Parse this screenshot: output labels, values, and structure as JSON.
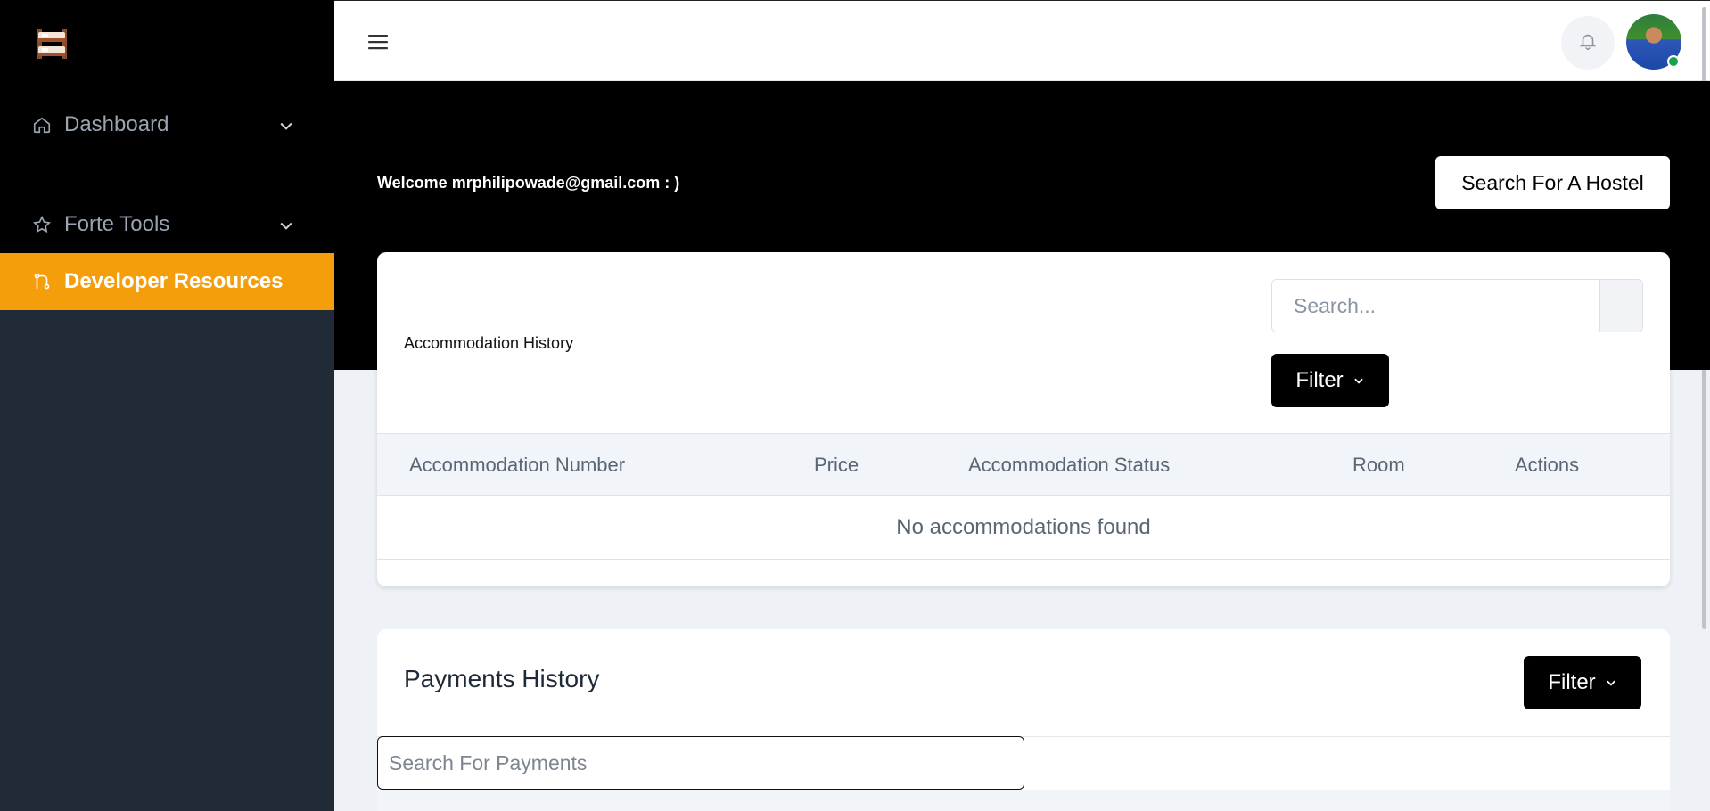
{
  "sidebar": {
    "items": [
      {
        "label": "Dashboard",
        "icon": "home-icon",
        "expandable": true
      },
      {
        "label": "Forte Tools",
        "icon": "star-icon",
        "expandable": true
      },
      {
        "label": "Developer Resources",
        "icon": "git-branch-icon",
        "active": true
      }
    ],
    "accent_color": "#f59e0b",
    "logo_icon": "bunk-bed-logo-icon"
  },
  "topbar": {
    "menu_icon": "hamburger-menu-icon",
    "notification_icon": "bell-icon",
    "avatar_status": "online"
  },
  "hero": {
    "welcome_text": "Welcome mrphilipowade@gmail.com : )",
    "search_hostel_label": "Search For A Hostel"
  },
  "accommodation": {
    "title": "Accommodation History",
    "search_placeholder": "Search...",
    "filter_label": "Filter",
    "columns": [
      "Accommodation Number",
      "Price",
      "Accommodation Status",
      "Room",
      "Actions"
    ],
    "empty_message": "No accommodations found"
  },
  "payments": {
    "title": "Payments History",
    "filter_label": "Filter",
    "search_placeholder": "Search For Payments"
  }
}
